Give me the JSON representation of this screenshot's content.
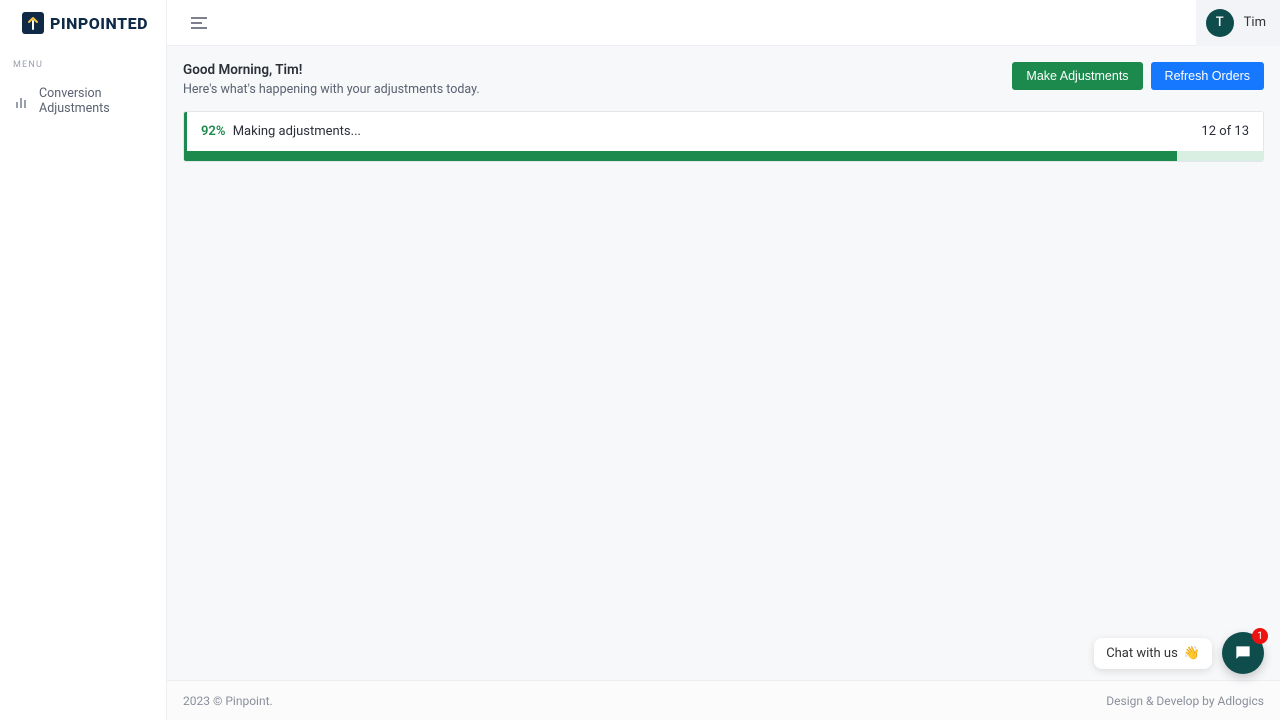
{
  "brand": {
    "name": "PINPOINTED"
  },
  "sidebar": {
    "menu_label": "MENU",
    "items": [
      {
        "label": "Conversion Adjustments"
      }
    ]
  },
  "user": {
    "initial": "T",
    "name": "Tim"
  },
  "header": {
    "greeting": "Good Morning, Tim!",
    "subtitle": "Here's what's happening with your adjustments today."
  },
  "actions": {
    "make_adjustments": "Make Adjustments",
    "refresh_orders": "Refresh Orders"
  },
  "progress": {
    "percent_label": "92%",
    "status_label": "Making adjustments...",
    "count_label": "12 of 13",
    "percent_value": 92
  },
  "footer": {
    "left": "2023 © Pinpoint.",
    "right_prefix": "Design & Develop by ",
    "right_link": "Adlogics"
  },
  "chat": {
    "pill_text": "Chat with us",
    "emoji": "👋",
    "badge": "1"
  }
}
